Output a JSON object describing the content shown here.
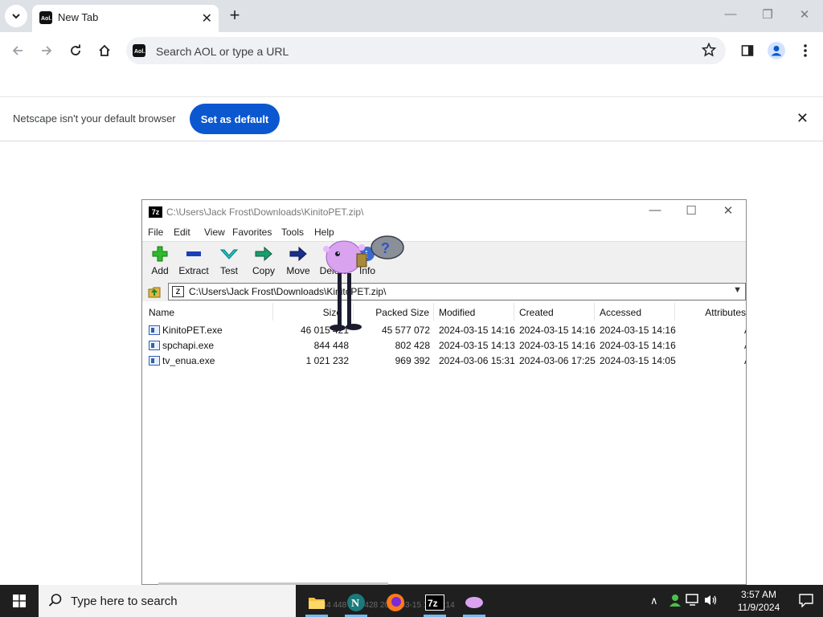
{
  "browser": {
    "tab_title": "New Tab",
    "omnibox_placeholder": "Search AOL or type a URL",
    "infobar_message": "Netscape isn't your default browser",
    "set_default_label": "Set as default"
  },
  "zip": {
    "title": "C:\\Users\\Jack Frost\\Downloads\\KinitoPET.zip\\",
    "path": "C:\\Users\\Jack Frost\\Downloads\\KinitoPET.zip\\",
    "menu": [
      "File",
      "Edit",
      "View",
      "Favorites",
      "Tools",
      "Help"
    ],
    "tools": [
      "Add",
      "Extract",
      "Test",
      "Copy",
      "Move",
      "Delete",
      "Info"
    ],
    "columns": [
      "Name",
      "Size",
      "Packed Size",
      "Modified",
      "Created",
      "Accessed",
      "Attributes"
    ],
    "files": [
      {
        "name": "KinitoPET.exe",
        "size": "46 015 421",
        "packed": "45 577 072",
        "modified": "2024-03-15 14:16",
        "created": "2024-03-15 14:16",
        "accessed": "2024-03-15 14:16",
        "attr": "A"
      },
      {
        "name": "spchapi.exe",
        "size": "844 448",
        "packed": "802 428",
        "modified": "2024-03-15 14:13",
        "created": "2024-03-15 14:16",
        "accessed": "2024-03-15 14:16",
        "attr": "A"
      },
      {
        "name": "tv_enua.exe",
        "size": "1 021 232",
        "packed": "969 392",
        "modified": "2024-03-06 15:31",
        "created": "2024-03-06 17:25",
        "accessed": "2024-03-15 14:05",
        "attr": "A"
      }
    ]
  },
  "taskbar": {
    "search_placeholder": "Type here to search",
    "ghost_text": "844 448   802 428   2024-03-15 14:13:14",
    "time": "3:57 AM",
    "date": "11/9/2024"
  },
  "colors": {
    "accent": "#0b57d0",
    "tabstrip": "#dee1e6",
    "taskbar": "#1f1f1f",
    "pet_body": "#d9a3f0"
  }
}
